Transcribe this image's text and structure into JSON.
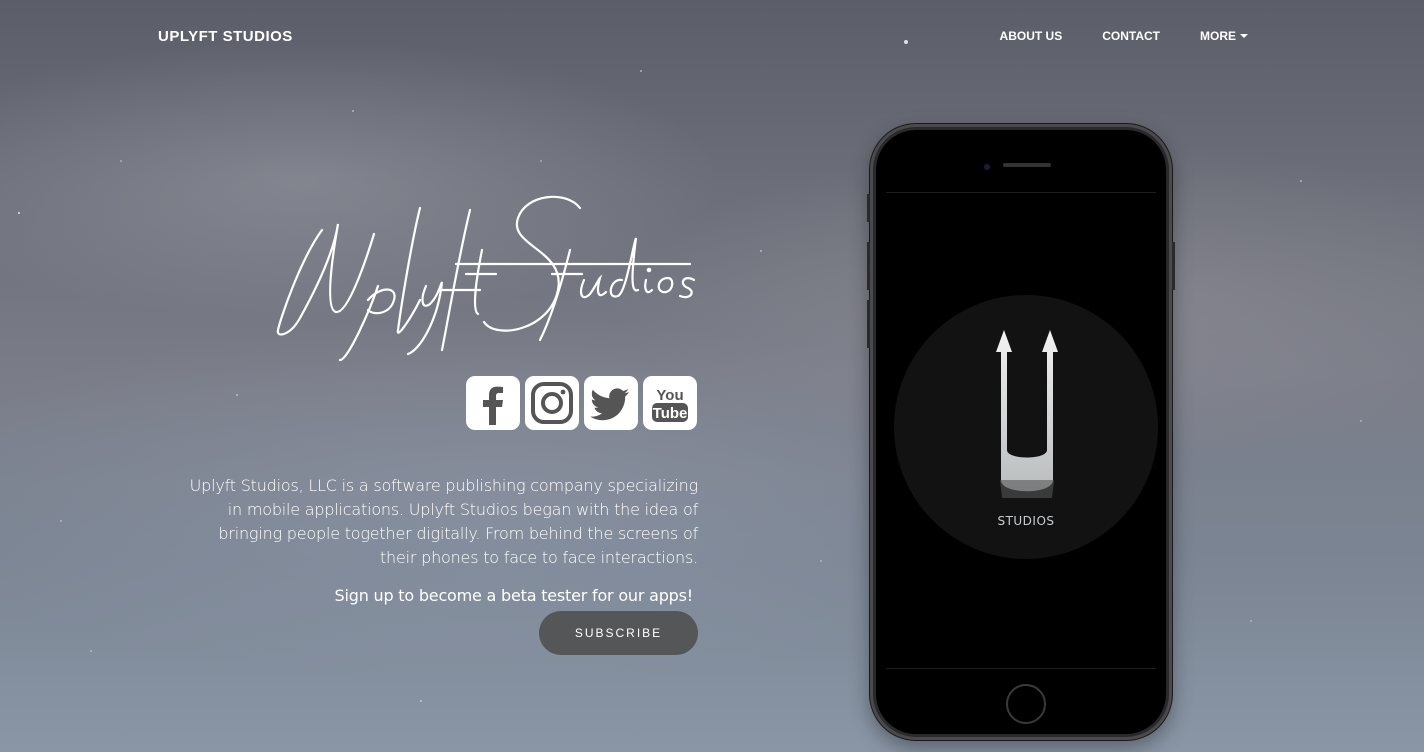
{
  "nav": {
    "brand": "UPLYFT STUDIOS",
    "links": [
      "ABOUT US",
      "CONTACT",
      "MORE"
    ]
  },
  "hero": {
    "script_logo_text": "Uplyft Studios",
    "social": [
      {
        "name": "Facebook",
        "icon": "facebook-icon"
      },
      {
        "name": "Instagram",
        "icon": "instagram-icon"
      },
      {
        "name": "Twitter",
        "icon": "twitter-icon"
      },
      {
        "name": "YouTube",
        "icon": "youtube-icon"
      }
    ],
    "about_text": "Uplyft Studios, LLC is a software publishing company specializing in mobile applications. Uplyft Studios began with the idea of bringing people together digitally. From behind the screens of their phones to face to face interactions.",
    "beta_text": "Sign up to become a beta tester for our apps!",
    "subscribe_label": "SUBSCRIBE"
  },
  "phone": {
    "screen_label": "STUDIOS"
  },
  "colors": {
    "button_bg": "#555658",
    "text": "#ffffff"
  }
}
